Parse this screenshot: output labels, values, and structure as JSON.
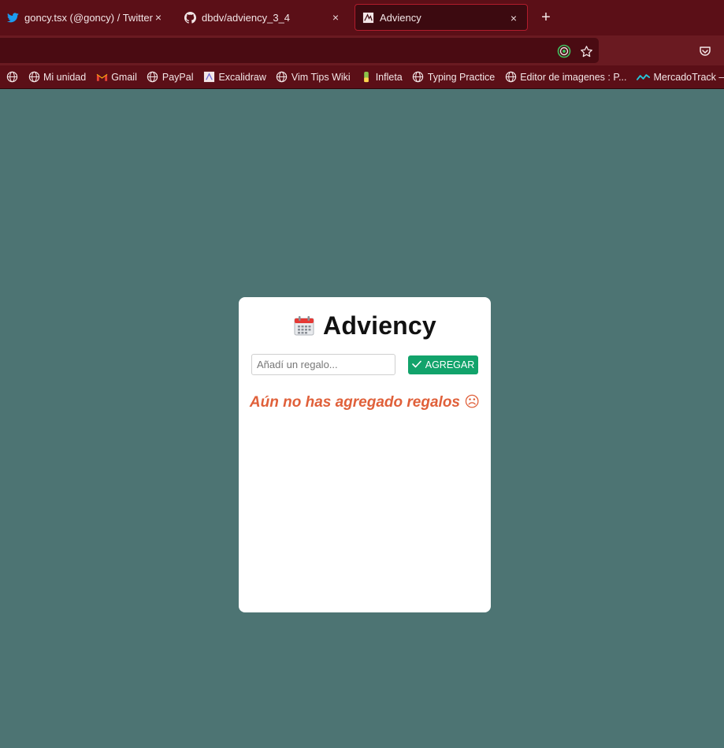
{
  "browser": {
    "tabs": [
      {
        "title": "goncy.tsx (@goncy) / Twitter",
        "icon": "twitter-icon",
        "close": "×"
      },
      {
        "title": "dbdv/adviency_3_4",
        "icon": "github-icon",
        "close": "×"
      },
      {
        "title": "Adviency",
        "icon": "adviency-icon",
        "close": "×",
        "active": true
      }
    ],
    "new_tab_label": "+",
    "bookmarks": [
      {
        "label": "Mi unidad",
        "icon": "globe-icon"
      },
      {
        "label": "Gmail",
        "icon": "gmail-icon"
      },
      {
        "label": "PayPal",
        "icon": "globe-icon"
      },
      {
        "label": "Excalidraw",
        "icon": "excalidraw-icon"
      },
      {
        "label": "Vim Tips Wiki",
        "icon": "globe-icon"
      },
      {
        "label": "Infleta",
        "icon": "infleta-icon"
      },
      {
        "label": "Typing Practice",
        "icon": "globe-icon"
      },
      {
        "label": "Editor de imagenes : P...",
        "icon": "globe-icon"
      },
      {
        "label": "MercadoTrack — Silla",
        "icon": "mercadotrack-icon"
      }
    ]
  },
  "app": {
    "title": "Adviency",
    "title_icon": "calendar-icon",
    "input_placeholder": "Añadí un regalo...",
    "input_value": "",
    "add_button_label": "AGREGAR",
    "empty_message": "Aún no has agregado regalos ☹"
  },
  "colors": {
    "page_background": "#4d7473",
    "chrome_tabbar": "#5b0f17",
    "add_button": "#12a36b",
    "empty_message": "#e0603a"
  }
}
